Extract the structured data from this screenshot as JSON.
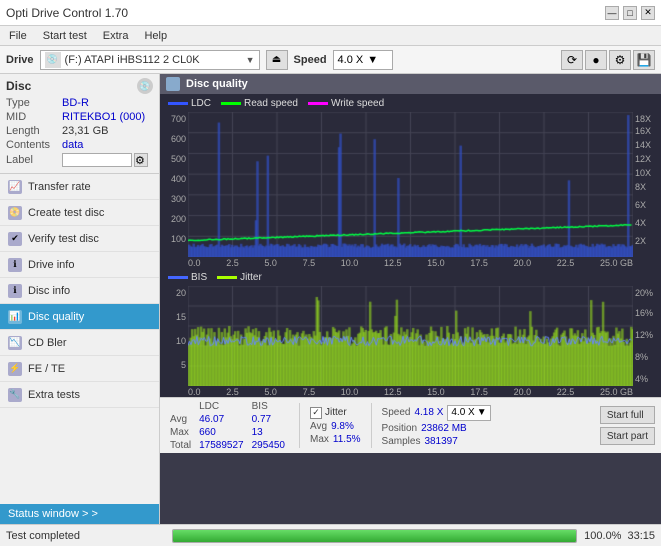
{
  "app": {
    "title": "Opti Drive Control 1.70",
    "title_controls": [
      "—",
      "□",
      "✕"
    ]
  },
  "menu": {
    "items": [
      "File",
      "Start test",
      "Extra",
      "Help"
    ]
  },
  "drive_bar": {
    "label": "Drive",
    "drive_value": "(F:)  ATAPI iHBS112  2 CL0K",
    "speed_label": "Speed",
    "speed_value": "4.0 X"
  },
  "disc": {
    "title": "Disc",
    "type_label": "Type",
    "type_value": "BD-R",
    "mid_label": "MID",
    "mid_value": "RITEKBO1 (000)",
    "length_label": "Length",
    "length_value": "23,31 GB",
    "contents_label": "Contents",
    "contents_value": "data",
    "label_label": "Label"
  },
  "nav": {
    "items": [
      {
        "id": "transfer-rate",
        "label": "Transfer rate",
        "active": false
      },
      {
        "id": "create-test-disc",
        "label": "Create test disc",
        "active": false
      },
      {
        "id": "verify-test-disc",
        "label": "Verify test disc",
        "active": false
      },
      {
        "id": "drive-info",
        "label": "Drive info",
        "active": false
      },
      {
        "id": "disc-info",
        "label": "Disc info",
        "active": false
      },
      {
        "id": "disc-quality",
        "label": "Disc quality",
        "active": true
      },
      {
        "id": "cd-bler",
        "label": "CD Bler",
        "active": false
      },
      {
        "id": "fe-te",
        "label": "FE / TE",
        "active": false
      },
      {
        "id": "extra-tests",
        "label": "Extra tests",
        "active": false
      }
    ]
  },
  "status_window": {
    "label": "Status window  > >"
  },
  "chart": {
    "title": "Disc quality",
    "legend": [
      {
        "color": "#3355ff",
        "label": "LDC"
      },
      {
        "color": "#00ff00",
        "label": "Read speed"
      },
      {
        "color": "#ff00ff",
        "label": "Write speed"
      }
    ],
    "legend2": [
      {
        "color": "#3355ff",
        "label": "BIS"
      },
      {
        "color": "#aaff00",
        "label": "Jitter"
      }
    ],
    "upper": {
      "y_labels": [
        "700",
        "600",
        "500",
        "400",
        "300",
        "200",
        "100"
      ],
      "y_labels_right": [
        "18X",
        "16X",
        "14X",
        "12X",
        "10X",
        "8X",
        "6X",
        "4X",
        "2X"
      ],
      "x_labels": [
        "0.0",
        "2.5",
        "5.0",
        "7.5",
        "10.0",
        "12.5",
        "15.0",
        "17.5",
        "20.0",
        "22.5",
        "25.0 GB"
      ]
    },
    "lower": {
      "y_labels": [
        "20",
        "15",
        "10",
        "5"
      ],
      "y_labels_right": [
        "20%",
        "16%",
        "12%",
        "8%",
        "4%"
      ],
      "x_labels": [
        "0.0",
        "2.5",
        "5.0",
        "7.5",
        "10.0",
        "12.5",
        "15.0",
        "17.5",
        "20.0",
        "22.5",
        "25.0 GB"
      ]
    }
  },
  "stats": {
    "ldc_label": "LDC",
    "bis_label": "BIS",
    "jitter_label": "Jitter",
    "avg_label": "Avg",
    "max_label": "Max",
    "total_label": "Total",
    "ldc_avg": "46.07",
    "ldc_max": "660",
    "ldc_total": "17589527",
    "bis_avg": "0.77",
    "bis_max": "13",
    "bis_total": "295450",
    "jitter_avg": "9.8%",
    "jitter_max": "11.5%",
    "speed_label": "Speed",
    "speed_val": "4.18 X",
    "position_label": "Position",
    "position_val": "23862 MB",
    "samples_label": "Samples",
    "samples_val": "381397",
    "speed_select": "4.0 X",
    "start_full_label": "Start full",
    "start_part_label": "Start part"
  },
  "progress": {
    "status": "Test completed",
    "percent": "100.0%",
    "percent_num": 100,
    "time": "33:15"
  },
  "colors": {
    "accent_blue": "#3399cc",
    "chart_bg": "#2a2a3a",
    "ldc_line": "#3355ff",
    "read_speed_line": "#00ff00",
    "bis_line": "#4466ff",
    "jitter_line": "#aaff00",
    "write_speed_line": "#ff00ff"
  }
}
